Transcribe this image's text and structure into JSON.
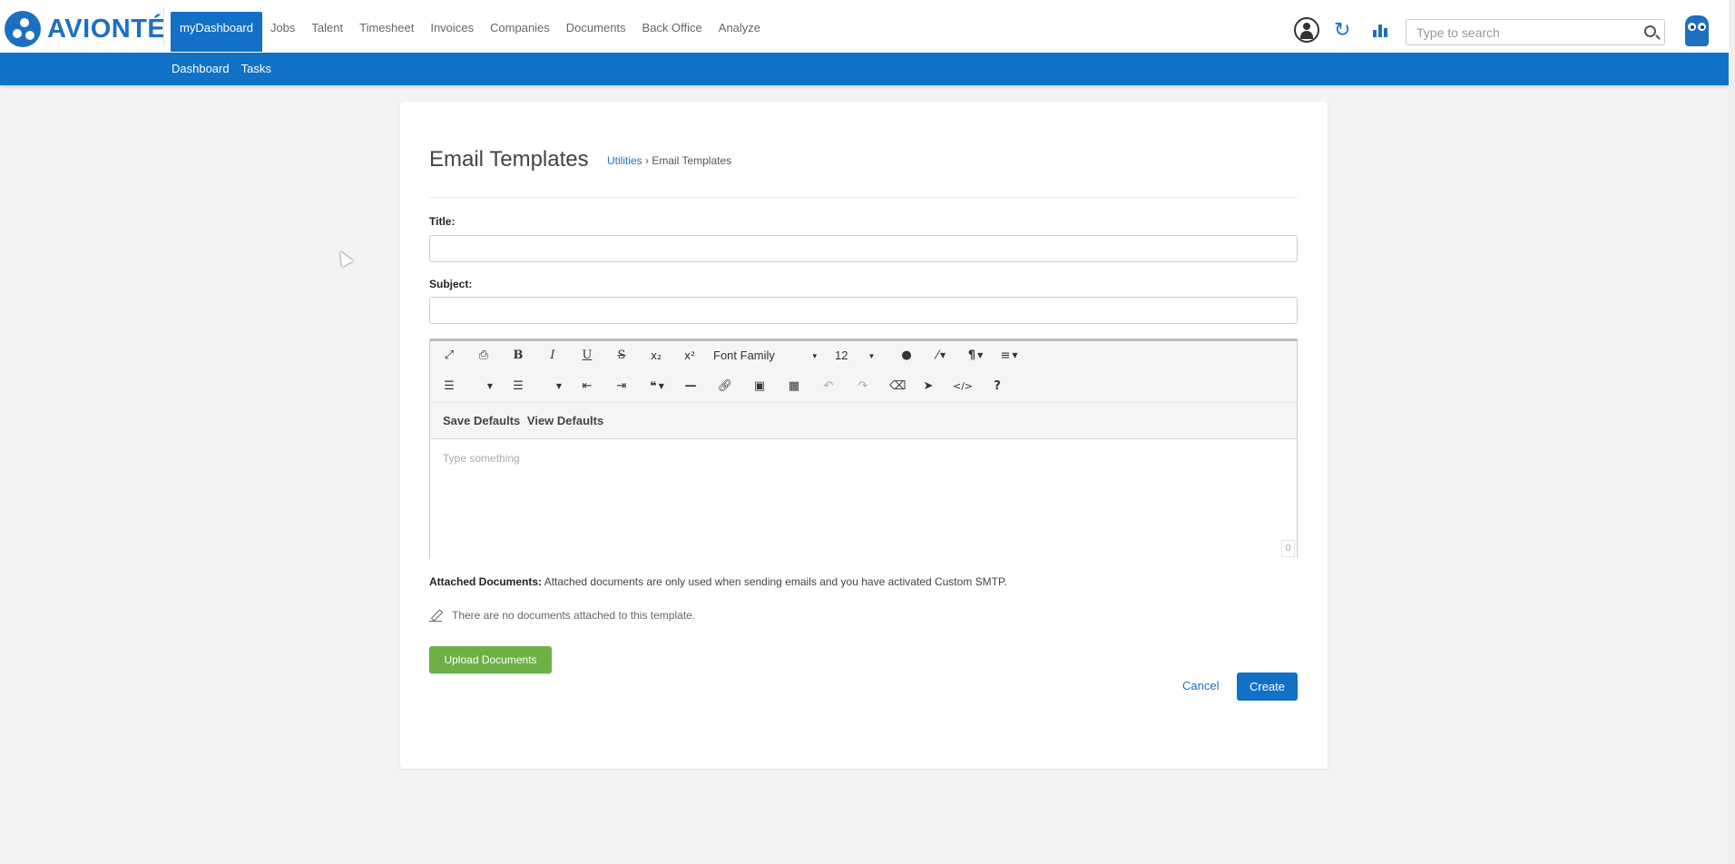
{
  "brand": {
    "name": "AVIONTÉ",
    "color": "#1d6fc2"
  },
  "nav": {
    "items": [
      "myDashboard",
      "Jobs",
      "Talent",
      "Timesheet",
      "Invoices",
      "Companies",
      "Documents",
      "Back Office",
      "Analyze"
    ],
    "active": "myDashboard"
  },
  "header_icons": [
    "user-icon",
    "refresh-icon",
    "bar-chart-icon",
    "owl-logo-icon"
  ],
  "search": {
    "placeholder": "Type to search"
  },
  "subnav": {
    "items": [
      "Dashboard",
      "Tasks"
    ]
  },
  "page": {
    "title": "Email Templates",
    "breadcrumb": {
      "link": "Utilities",
      "separator": " › ",
      "current": "Email Templates"
    }
  },
  "form": {
    "title_label": "Title:",
    "title_value": "",
    "subject_label": "Subject:",
    "subject_value": ""
  },
  "editor": {
    "toolbar_row1": [
      "expand-icon",
      "print-icon",
      "bold-icon",
      "italic-icon",
      "underline-icon",
      "strikethrough-icon",
      "subscript-icon",
      "superscript-icon"
    ],
    "font_family": "Font Family",
    "font_size": "12",
    "toolbar_row2": [
      "ordered-list-icon",
      "unordered-list-icon",
      "outdent-icon",
      "indent-icon",
      "quote-icon",
      "horizontal-rule-icon",
      "link-icon",
      "image-icon",
      "table-icon",
      "undo-icon",
      "redo-icon",
      "clear-format-icon",
      "select-all-icon",
      "code-view-icon",
      "help-icon"
    ],
    "save_defaults": "Save Defaults",
    "view_defaults": "View Defaults",
    "placeholder": "Type something",
    "char_count": "0"
  },
  "attachments": {
    "label": "Attached Documents:",
    "note": " Attached documents are only used when sending emails and you have activated Custom SMTP.",
    "empty_text": "There are no documents attached to this template.",
    "upload_label": "Upload Documents"
  },
  "actions": {
    "cancel": "Cancel",
    "create": "Create"
  },
  "colors": {
    "primary": "#1270c6",
    "upload": "#6db046",
    "background": "#f3f3f5"
  }
}
